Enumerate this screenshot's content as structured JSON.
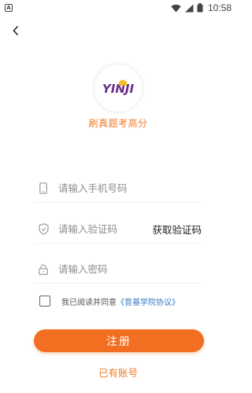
{
  "status_bar": {
    "time": "10:58",
    "notification_icon_letter": "A",
    "icons": [
      "wifi-icon",
      "signal-icon",
      "battery-icon"
    ]
  },
  "header": {
    "back_icon": "chevron-left-icon"
  },
  "brand": {
    "logo_text": "YINJI",
    "tagline": "刷真题考高分",
    "accent_color": "#f26f22",
    "logo_color": "#6a2c8c",
    "logo_highlight": "#f2b90f"
  },
  "form": {
    "phone_placeholder": "请输入手机号码",
    "code_placeholder": "请输入验证码",
    "get_code_label": "获取验证码",
    "password_placeholder": "请输入密码"
  },
  "agreement": {
    "prefix": "我已阅读并同意",
    "link": "《音基学院协议》"
  },
  "actions": {
    "register_label": "注册",
    "have_account_label": "已有账号"
  }
}
